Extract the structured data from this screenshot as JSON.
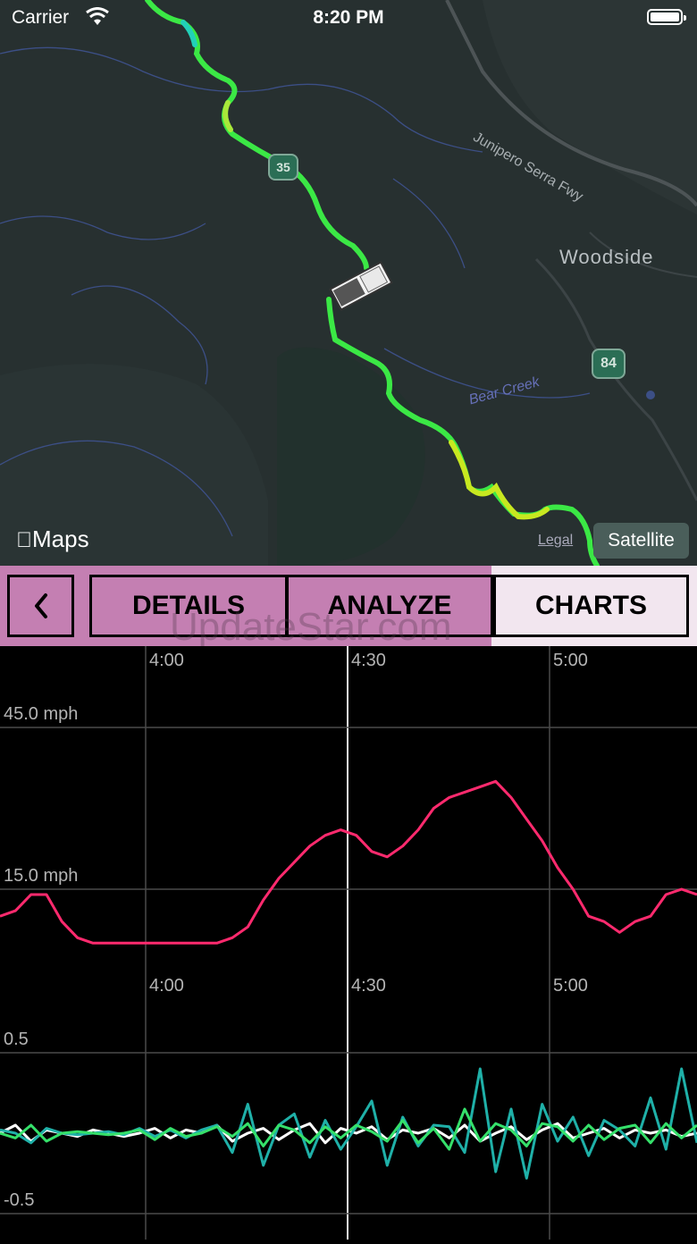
{
  "status_bar": {
    "carrier": "Carrier",
    "time": "8:20 PM"
  },
  "map": {
    "place_label": "Woodside",
    "road_label": "Junipero Serra Fwy",
    "creek_label": "Bear Creek",
    "shield_84": "84",
    "shield_35": "35",
    "maps_logo": "Maps",
    "legal": "Legal",
    "satellite_button": "Satellite"
  },
  "toolbar": {
    "back_icon": "chevron-left-icon",
    "details": "DETAILS",
    "analyze": "ANALYZE",
    "charts": "CHARTS",
    "watermark": "UpdateStar.com",
    "active_color": "#f2e6ef",
    "inactive_color": "#c47fb2"
  },
  "chart_data": [
    {
      "type": "line",
      "x_ticks": [
        "4:00",
        "4:30",
        "5:00"
      ],
      "y_ticks": [
        "45.0 mph",
        "15.0 mph"
      ],
      "ylim": [
        0,
        45
      ],
      "series": [
        {
          "color": "#ff2a6e",
          "values": [
            10,
            11,
            14,
            14,
            9,
            6,
            5,
            5,
            5,
            5,
            5,
            5,
            5,
            5,
            5,
            6,
            8,
            13,
            17,
            20,
            23,
            25,
            26,
            25,
            22,
            21,
            23,
            26,
            30,
            32,
            33,
            34,
            35,
            32,
            28,
            24,
            19,
            15,
            10,
            9,
            7,
            9,
            10,
            14,
            15,
            14
          ]
        }
      ]
    },
    {
      "type": "line",
      "x_ticks": [
        "4:00",
        "4:30",
        "5:00"
      ],
      "y_ticks": [
        "0.5",
        "-0.5"
      ],
      "ylim": [
        -0.5,
        0.5
      ],
      "series": [
        {
          "color": "#ffffff",
          "values": [
            0.0,
            0.05,
            -0.05,
            0.02,
            0.0,
            -0.02,
            0.02,
            0.0,
            -0.02,
            0.0,
            0.03,
            -0.03,
            0.02,
            0.0,
            0.05,
            -0.05,
            0.0,
            0.03,
            -0.04,
            0.02,
            0.06,
            -0.06,
            0.03,
            0.0,
            0.04,
            -0.04,
            0.02,
            0.0,
            0.03,
            -0.03,
            0.05,
            -0.05,
            0.0,
            0.04,
            -0.04,
            0.02,
            0.06,
            -0.03,
            0.0,
            0.03,
            -0.03,
            0.02,
            0.0,
            0.02,
            -0.02,
            0.0
          ]
        },
        {
          "color": "#1fb0a8",
          "values": [
            0.02,
            0.0,
            -0.06,
            0.03,
            0.0,
            -0.01,
            0.0,
            0.01,
            -0.01,
            0.03,
            -0.02,
            0.02,
            -0.03,
            0.02,
            0.05,
            -0.12,
            0.18,
            -0.2,
            0.05,
            0.12,
            -0.15,
            0.08,
            -0.1,
            0.04,
            0.2,
            -0.2,
            0.1,
            -0.08,
            0.05,
            0.04,
            -0.12,
            0.4,
            -0.24,
            0.15,
            -0.28,
            0.18,
            -0.05,
            0.1,
            -0.14,
            0.08,
            0.02,
            -0.08,
            0.22,
            -0.1,
            0.4,
            -0.06
          ]
        },
        {
          "color": "#35e06a",
          "values": [
            0.0,
            -0.03,
            0.05,
            -0.05,
            0.0,
            0.01,
            0.0,
            -0.01,
            0.0,
            0.02,
            -0.04,
            0.03,
            -0.02,
            0.0,
            0.04,
            -0.02,
            0.06,
            -0.08,
            0.05,
            0.02,
            -0.06,
            0.04,
            -0.03,
            0.05,
            0.01,
            -0.05,
            0.08,
            -0.06,
            0.03,
            -0.1,
            0.15,
            -0.05,
            0.06,
            0.02,
            -0.08,
            0.06,
            0.04,
            -0.05,
            0.05,
            -0.04,
            0.03,
            0.05,
            -0.06,
            0.06,
            -0.03,
            0.05
          ]
        }
      ]
    }
  ]
}
